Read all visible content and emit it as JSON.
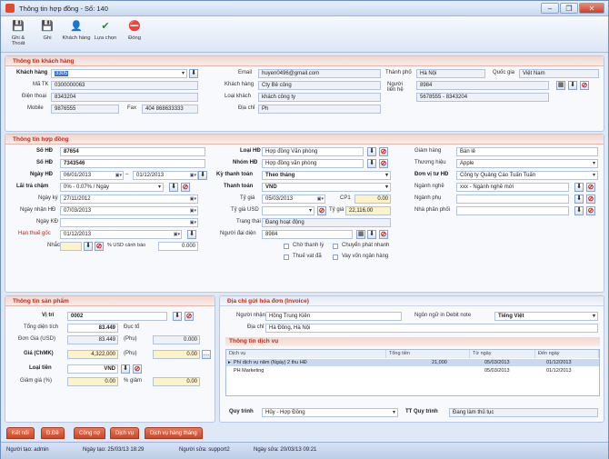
{
  "window": {
    "title": "Thông tin hợp đồng - Số: 140",
    "controls": [
      "–",
      "❐",
      "✕"
    ]
  },
  "toolbar": [
    {
      "label": "Ghi & Thoát",
      "icon": "save-exit-icon",
      "glyph": "💾"
    },
    {
      "label": "Ghi",
      "icon": "save-icon",
      "glyph": "💾"
    },
    {
      "label": "Khách hàng",
      "icon": "customer-icon",
      "glyph": "👤"
    },
    {
      "label": "Lựa chọn",
      "icon": "select-icon",
      "glyph": "✔"
    },
    {
      "label": "Đóng",
      "icon": "close-icon",
      "glyph": "⛔"
    }
  ],
  "customer": {
    "header": "Thông tin khách hàng",
    "code_label": "Khách hàng",
    "code": "3305",
    "tax_label": "Mã TK",
    "tax": "0300000063",
    "phone_label": "Điện thoại",
    "phone": "8343204",
    "mobile_label": "Mobile",
    "mobile": "9876555",
    "fax_label": "Fax",
    "fax": "404 868633333",
    "email_label": "Email",
    "email": "huyen0496@gmail.com",
    "name_label": "Khách hàng",
    "name": "Cty Bê công",
    "type_label": "Loại khách",
    "type": "khách công ty",
    "address_label": "Địa chỉ",
    "address": "Ph",
    "city_label": "Thành phố",
    "city": "Hà Nội",
    "country_label": "Quốc gia",
    "country": "Việt Nam",
    "contact_label": "Người liên hệ",
    "contact_1": "8984",
    "contact_2": "5678555 - 8343204"
  },
  "contract": {
    "header": "Thông tin hợp đồng",
    "no_label": "Số HĐ",
    "no": "87654",
    "no2_label": "Số HĐ",
    "no2": "7343546",
    "sign_label": "Ngày HĐ",
    "sign_from": "06/01/2013",
    "sign_to": "01/12/2013",
    "interest_label": "Lãi trả chậm",
    "interest": "0% - 0.07% / Ngày",
    "sign_date_label": "Ngày ký",
    "sign_date": "27/11/2012",
    "receive_label": "Ngày nhận HĐ",
    "receive_date": "07/03/2013",
    "end_label": "Ngày KĐ",
    "end_date": "",
    "pay_deadline_label": "Hạn thuế gốc",
    "pay_deadline": "01/12/2013",
    "remind_label": "Nhắc",
    "remind_note": "% USD cảnh báo",
    "remind_value": "0.000",
    "type_label": "Loại HĐ",
    "type": "Hợp đồng Văn phòng",
    "group_label": "Nhóm HĐ",
    "group": "Hợp đồng văn phòng",
    "pay_period_label": "Kỳ thanh toán",
    "pay_period": "Theo tháng",
    "currency_label": "Thanh toán",
    "currency": "VND",
    "rate_label": "Tỷ giá",
    "rate_date": "05/03/2013",
    "rate_code": "CP1",
    "rate_value": "0.00",
    "usd_label": "Tỷ giá USD",
    "usd_rate": "22,116.00",
    "usd_rate_label": "Tỷ giá",
    "status_label": "Trạng thái",
    "status": "Đang hoạt động",
    "place_label": "Người đại diện",
    "place": "8984",
    "checks": [
      "Chờ thanh lý",
      "Chuyển phát nhanh",
      "Thuế vat đã",
      "Vay vốn ngân hàng"
    ],
    "seller_label": "Giám hàng",
    "seller": "Bán lẻ",
    "brand_label": "Thương hiệu",
    "brand": "Apple",
    "agent_label": "Đơn vị tư HĐ",
    "agent": "Công ty Quảng Cáo Tuấn Tuấn",
    "industry_label": "Ngành nghề",
    "industry": "xxx - Ngành nghề mới",
    "sub_label": "Ngành phụ",
    "sub": "",
    "dist_label": "Nhà phân phối",
    "dist": ""
  },
  "product": {
    "header": "Thông tin sản phẩm",
    "pos_label": "Vị trí",
    "pos": "0002",
    "area_label": "Tổng diện tích",
    "area": "83.449",
    "area_unit": "Đục tổ",
    "price_usd_label": "Đơn Giá (USD)",
    "price_usd": "83.449",
    "price_unit": "(Phụ)",
    "price_usd2": "0.000",
    "price_vnd_label": "Giá (ChMK)",
    "price_vnd": "4,322,000",
    "price_vnd_unit": "(Phụ)",
    "price_vnd2": "0.00",
    "currency_label": "Loại tiền",
    "currency": "VND",
    "discount_label": "Giảm giá (%)",
    "discount": "0.00",
    "discount_note": "% giảm",
    "discount2": "0.00"
  },
  "invoice": {
    "header": "Địa chỉ gửi hóa đơn (Invoice)",
    "receiver_label": "Người nhận",
    "receiver": "Hồng Trung Kiên",
    "lang_label": "Ngôn ngữ in Debit note",
    "lang": "Tiếng Việt",
    "address_label": "Địa chỉ",
    "address": "Hà Đông, Hà Nội"
  },
  "services": {
    "header": "Thông tin dịch vụ",
    "columns": [
      "Dịch vụ",
      "Tổng tiền",
      "Từ ngày",
      "Đến ngày"
    ],
    "rows": [
      [
        "Phí dịch vụ năm (Ngày) 2 thu HĐ",
        "21,000",
        "05/03/2013",
        "01/12/2013"
      ],
      [
        "PH Marketing",
        "",
        "05/03/2013",
        "01/12/2013"
      ]
    ]
  },
  "process": {
    "label": "Quy trình",
    "value": "Hủy - Hợp Đồng",
    "tt_label": "TT Quy trình",
    "tt_value": "Đang làm thủ tục"
  },
  "tabs": [
    "Kết nối",
    "Đ.Đề",
    "Công nợ",
    "Dịch vụ",
    "Dịch vụ hàng tháng"
  ],
  "status": [
    "Người tạo: admin",
    "Ngày tạo: 25/03/13 18:29",
    "Người sửa: support2",
    "Ngày sửa: 20/03/13 09:21"
  ]
}
